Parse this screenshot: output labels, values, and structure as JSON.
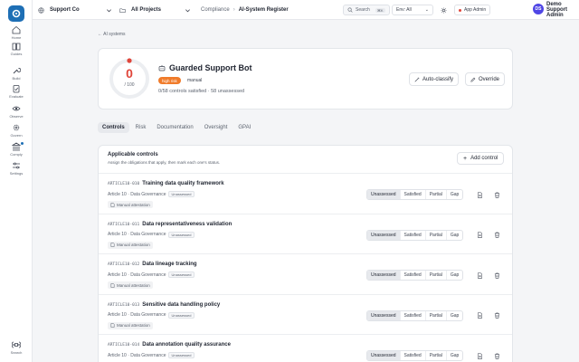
{
  "nav": {
    "items": [
      {
        "label": "Home",
        "icon": "home-icon"
      },
      {
        "label": "Guides",
        "icon": "book-icon"
      },
      {
        "label": "Build",
        "icon": "wrench-icon"
      },
      {
        "label": "Evaluate",
        "icon": "clipboard-icon"
      },
      {
        "label": "Observe",
        "icon": "eye-icon"
      },
      {
        "label": "Govern",
        "icon": "gear-icon"
      },
      {
        "label": "Comply",
        "icon": "bank-icon"
      },
      {
        "label": "Settings",
        "icon": "sliders-icon"
      }
    ],
    "search_label": "Search"
  },
  "topbar": {
    "org": "Support Co",
    "project": "All Projects",
    "breadcrumb_parent": "Compliance",
    "breadcrumb_current": "AI-System Register",
    "search_label": "Search",
    "search_shortcut": "⌘K",
    "env_label": "Env: All",
    "admin_label": "App Admin",
    "user_initials": "DS",
    "user_name": "Demo Support Admin"
  },
  "back_link": "← AI systems",
  "system": {
    "score": "0",
    "score_total": "/ 100",
    "name": "Guarded Support Bot",
    "risk_label": "high risk",
    "mode": "manual",
    "summary": "0/58 controls satisfied · 58 unassessed",
    "autoclassify_label": "Auto-classify",
    "override_label": "Override"
  },
  "tabs": [
    "Controls",
    "Risk",
    "Documentation",
    "Oversight",
    "GPAI"
  ],
  "panel": {
    "title": "Applicable controls",
    "subtitle": "Assign the obligations that apply, then mark each one's status.",
    "add_label": "Add control",
    "status_options": [
      "Unassessed",
      "Satisfied",
      "Partial",
      "Gap"
    ],
    "rows": [
      {
        "code": "ARTICLE10-010",
        "name": "Training data quality framework",
        "meta": "Article 10 · Data Governance",
        "status": "Unassessed",
        "attestation": "Manual attestation"
      },
      {
        "code": "ARTICLE10-011",
        "name": "Data representativeness validation",
        "meta": "Article 10 · Data Governance",
        "status": "Unassessed",
        "attestation": "Manual attestation"
      },
      {
        "code": "ARTICLE10-012",
        "name": "Data lineage tracking",
        "meta": "Article 10 · Data Governance",
        "status": "Unassessed",
        "attestation": "Manual attestation"
      },
      {
        "code": "ARTICLE10-013",
        "name": "Sensitive data handling policy",
        "meta": "Article 10 · Data Governance",
        "status": "Unassessed",
        "attestation": "Manual attestation"
      },
      {
        "code": "ARTICLE10-014",
        "name": "Data annotation quality assurance",
        "meta": "Article 10 · Data Governance",
        "status": "Unassessed",
        "attestation": "Manual attestation"
      }
    ]
  },
  "colors": {
    "accent": "#1e6fb5",
    "danger": "#e0453a",
    "risk": "#f07b2a",
    "avatar": "#4f46e5"
  }
}
